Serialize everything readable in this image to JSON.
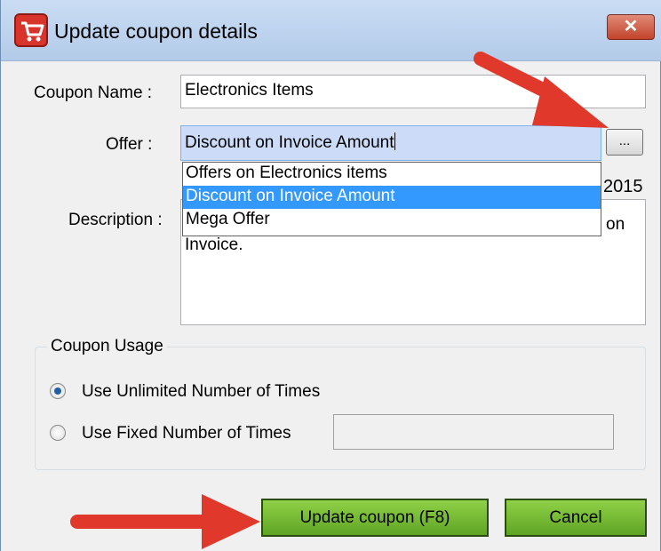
{
  "window": {
    "title": "Update coupon details",
    "close_label": "✕"
  },
  "form": {
    "coupon_name": {
      "label": "Coupon Name :",
      "value": "Electronics Items"
    },
    "offer": {
      "label": "Offer :",
      "value": "Discount on Invoice Amount",
      "browse_label": "...",
      "options": [
        "Offers on Electronics items",
        "Discount on Invoice Amount",
        "Mega Offer"
      ],
      "selected_index": 1
    },
    "date_fragment": "2015",
    "description": {
      "label": "Description :",
      "fragment": "on",
      "visible_text": "Invoice."
    }
  },
  "usage": {
    "title": "Coupon Usage",
    "option_unlimited": "Use Unlimited Number of Times",
    "option_fixed": "Use Fixed Number of Times",
    "selected": "unlimited",
    "fixed_value": ""
  },
  "actions": {
    "update_label": "Update coupon (F8)",
    "cancel_label": "Cancel"
  },
  "colors": {
    "annotation_arrow": "#e0392b",
    "button_green": "#76bd35"
  }
}
